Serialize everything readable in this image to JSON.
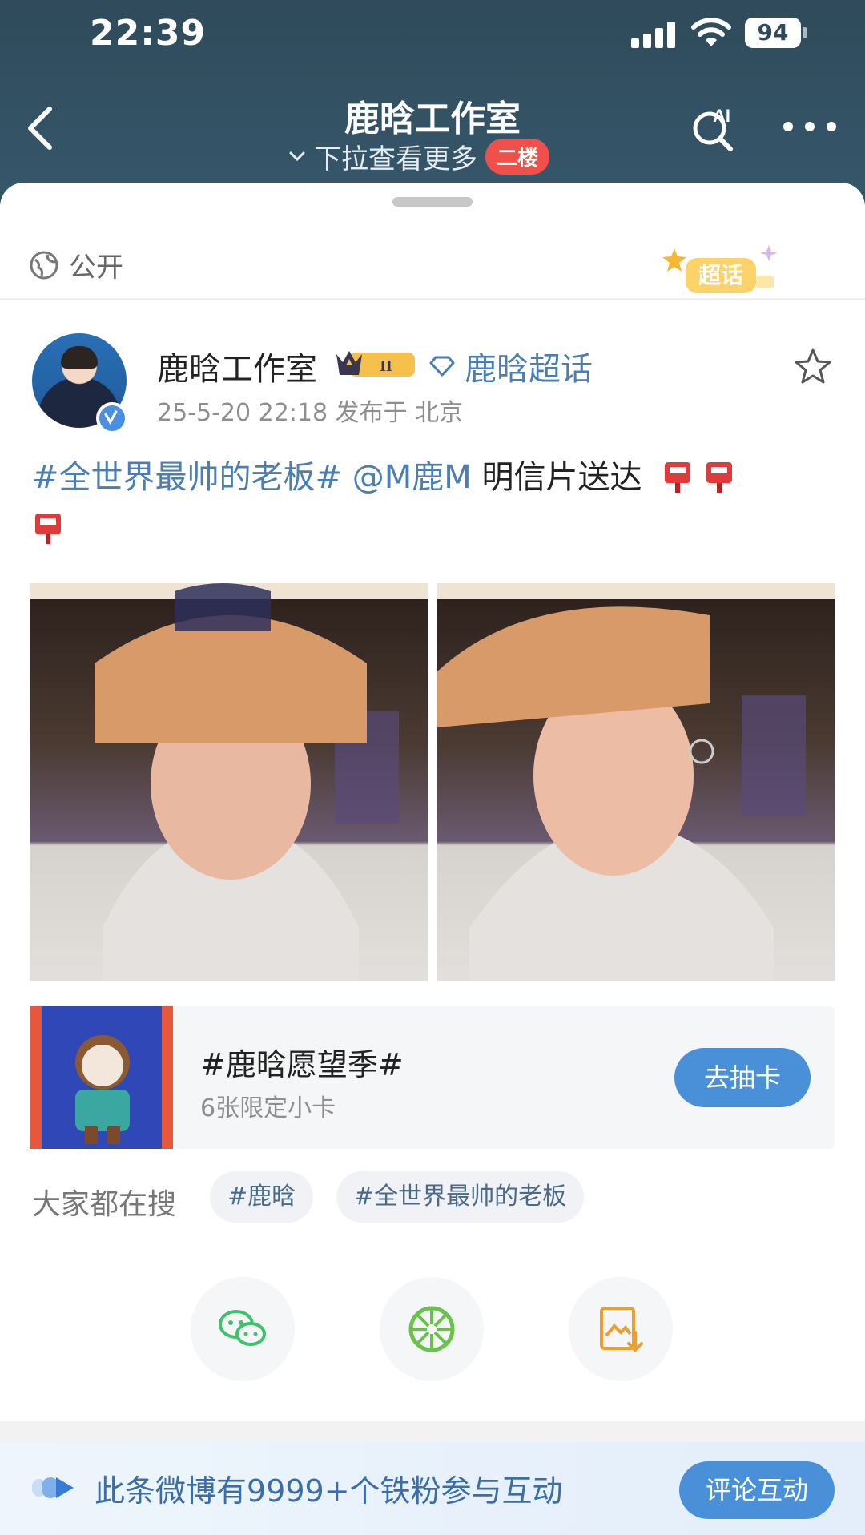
{
  "status_bar": {
    "time": "22:39",
    "battery": "94"
  },
  "nav": {
    "title": "鹿晗工作室",
    "pull_hint": "下拉查看更多",
    "floor_badge": "二楼",
    "ai_label": "AI"
  },
  "post": {
    "visibility": "公开",
    "supertopic_badge": "超话",
    "author": "鹿晗工作室",
    "level_badge": "II",
    "topic_link": "鹿晗超话",
    "meta": "25-5-20 22:18  发布于 北京",
    "text": {
      "hashtag": "#全世界最帅的老板#",
      "mention": "@M鹿M",
      "body": "明信片送达"
    }
  },
  "card": {
    "title": "#鹿晗愿望季#",
    "subtitle": "6张限定小卡",
    "button": "去抽卡"
  },
  "search": {
    "label": "大家都在搜",
    "tags": [
      "#鹿晗",
      "#全世界最帅的老板"
    ]
  },
  "fan_bar": {
    "text": "此条微博有9999+个铁粉参与互动",
    "button": "评论互动"
  },
  "colors": {
    "header_bg": "#2f4b5b",
    "link_blue": "#4a7eb5",
    "accent_blue": "#4a90d9",
    "badge_red": "#f0504a",
    "wechat_green": "#3cc36b"
  }
}
